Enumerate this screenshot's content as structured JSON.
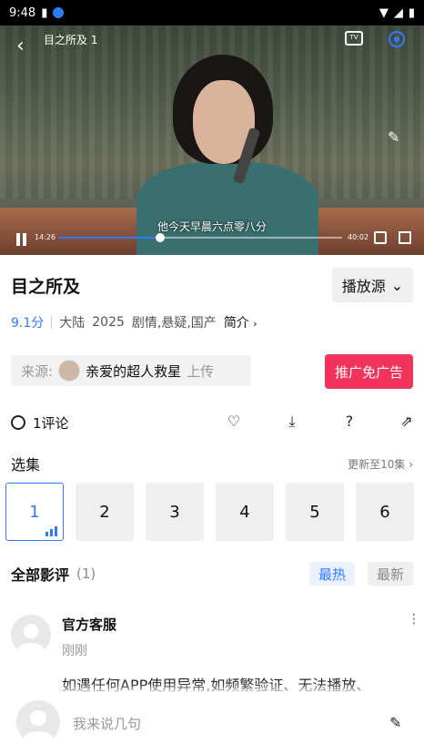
{
  "status": {
    "time": "9:48"
  },
  "player": {
    "title": "目之所及 1",
    "subtitle": "他今天早晨六点零八分",
    "current_time": "14:26",
    "duration": "40:02",
    "progress": 0.36,
    "tv_label": "TV"
  },
  "show": {
    "title": "目之所及",
    "source_button": "播放源",
    "score": "9.1分",
    "region": "大陆",
    "year": "2025",
    "genres": "剧情,悬疑,国产",
    "intro_label": "简介"
  },
  "uploader": {
    "prefix": "来源:",
    "name": "亲爱的超人救星",
    "suffix": "上传"
  },
  "promo_button": "推广免广告",
  "actions": {
    "comment_count": "1评论"
  },
  "episodes": {
    "label": "选集",
    "update": "更新至10集",
    "items": [
      "1",
      "2",
      "3",
      "4",
      "5",
      "6"
    ]
  },
  "reviews": {
    "label": "全部影评",
    "count": "(1)",
    "sort_hot": "最热",
    "sort_new": "最新",
    "items": [
      {
        "name": "官方客服",
        "time": "刚刚",
        "text": "如遇任何APP使用异常,如频繁验证、无法播放、"
      }
    ]
  },
  "input": {
    "placeholder": "我来说几句"
  },
  "colors": {
    "accent": "#2f7bff",
    "promo": "#f2335b"
  }
}
